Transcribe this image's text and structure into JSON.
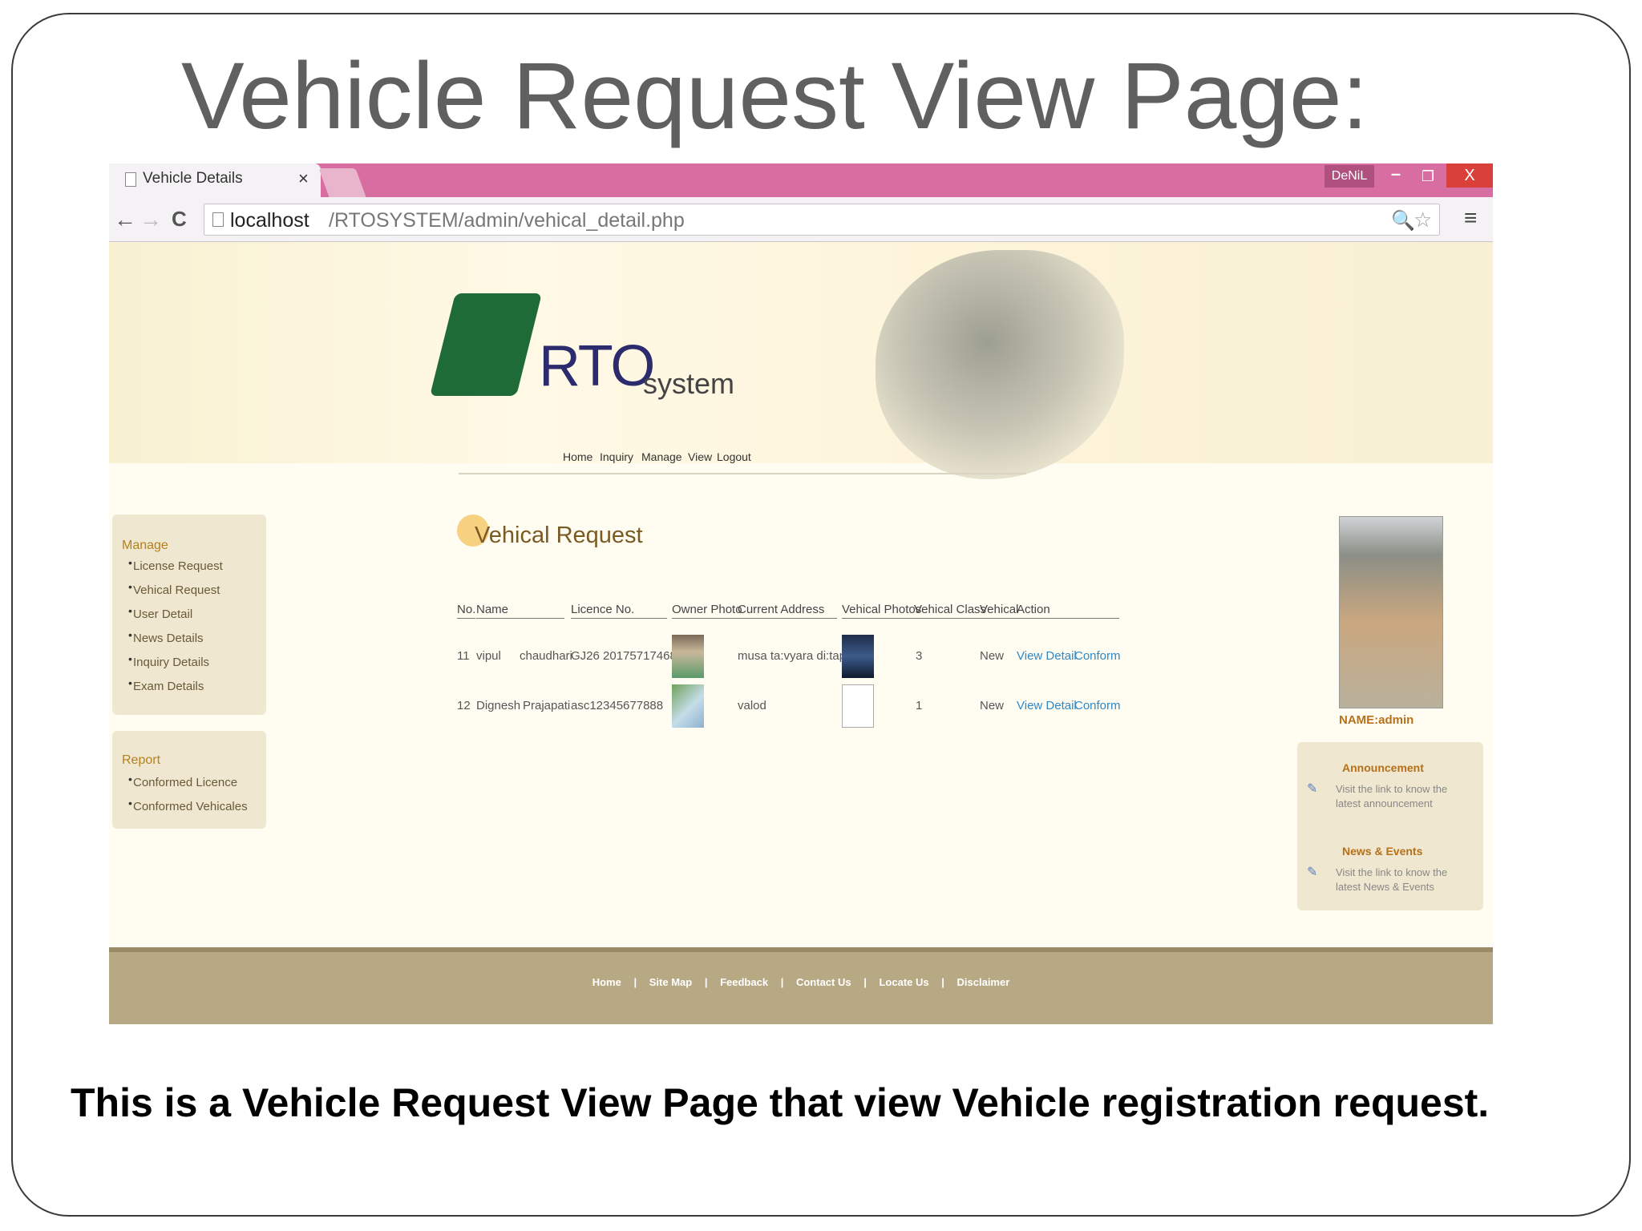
{
  "slide": {
    "title": "Vehicle Request View Page:",
    "caption": "This is a Vehicle Request View Page that view Vehicle registration request."
  },
  "browser": {
    "tab_title": "Vehicle Details",
    "tab_close": "×",
    "user_badge": "DeNiL",
    "min_label": "–",
    "max_label": "❐",
    "close_label": "X",
    "url_host": "localhost",
    "url_path": "/RTOSYSTEM/admin/vehical_detail.php",
    "back_icon": "←",
    "forward_icon": "→",
    "reload_icon": "C",
    "zoom_icon": "🔍",
    "star_icon": "☆",
    "menu_icon": "≡"
  },
  "site": {
    "logo_text": "RTO",
    "logo_sub": "system",
    "nav": [
      "Home",
      "Inquiry",
      "Manage",
      "View",
      "Logout"
    ]
  },
  "sidebar": {
    "manage_head": "Manage",
    "manage_items": [
      "License Request",
      "Vehical Request",
      "User Detail",
      "News Details",
      "Inquiry Details",
      "Exam Details"
    ],
    "report_head": "Report",
    "report_items": [
      "Conformed Licence",
      "Conformed Vehicales"
    ]
  },
  "main": {
    "title": "Vehical Request",
    "columns": [
      "No.",
      "Name",
      "Licence No.",
      "Owner Photo",
      "Current Address",
      "Vehical Photos",
      "Vehical Class",
      "Vehical",
      "Action"
    ],
    "rows": [
      {
        "no": "11",
        "first": "vipul",
        "last": "chaudhari",
        "licence": "GJ26 201757174682",
        "address": "musa ta:vyara di:tapi",
        "vclass": "3",
        "vtype": "New",
        "view": "View Detail",
        "confirm": "Conform"
      },
      {
        "no": "12",
        "first": "Dignesh",
        "last": "Prajapati",
        "licence": "asc12345677888",
        "address": "valod",
        "vclass": "1",
        "vtype": "New",
        "view": "View Detail",
        "confirm": "Conform"
      }
    ]
  },
  "right": {
    "name_label": "NAME:admin",
    "announcement_head": "Announcement",
    "announcement_text": "Visit the link to know the latest announcement",
    "news_head": "News & Events",
    "news_text": "Visit the link to know the latest News & Events"
  },
  "footer": {
    "links": [
      "Home",
      "Site Map",
      "Feedback",
      "Contact Us",
      "Locate Us",
      "Disclaimer"
    ],
    "separator": "|"
  },
  "colors": {
    "titlebar": "#d76da0",
    "accent_link": "#2d88c8",
    "footer": "#b8a985"
  }
}
